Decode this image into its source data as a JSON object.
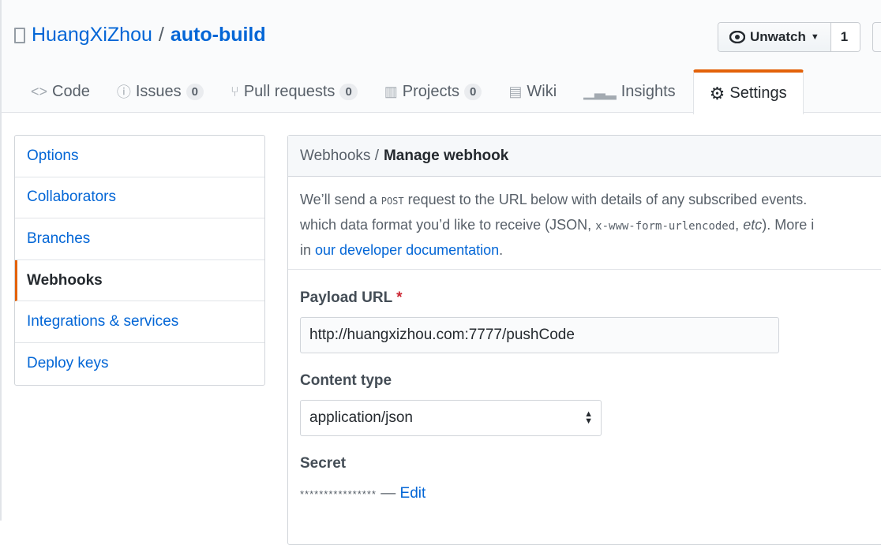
{
  "repo": {
    "owner": "HuangXiZhou",
    "separator": "/",
    "name": "auto-build"
  },
  "watch": {
    "label": "Unwatch",
    "count": "1"
  },
  "tabs": [
    {
      "label": "Code",
      "icon": "code-icon"
    },
    {
      "label": "Issues",
      "count": "0",
      "icon": "issue-icon"
    },
    {
      "label": "Pull requests",
      "count": "0",
      "icon": "pull-request-icon"
    },
    {
      "label": "Projects",
      "count": "0",
      "icon": "project-icon"
    },
    {
      "label": "Wiki",
      "icon": "book-icon"
    },
    {
      "label": "Insights",
      "icon": "graph-icon"
    },
    {
      "label": "Settings",
      "icon": "gear-icon",
      "selected": true
    }
  ],
  "sidebar": {
    "items": [
      {
        "label": "Options"
      },
      {
        "label": "Collaborators"
      },
      {
        "label": "Branches"
      },
      {
        "label": "Webhooks",
        "selected": true
      },
      {
        "label": "Integrations & services"
      },
      {
        "label": "Deploy keys"
      }
    ]
  },
  "main": {
    "breadcrumb": {
      "parent": "Webhooks /",
      "current": "Manage webhook"
    },
    "desc": {
      "l1a": "We’ll send a ",
      "l1code": "POST",
      "l1b": " request to the URL below with details of any subscribed events.",
      "l2a": "which data format you’d like to receive (JSON, ",
      "l2code": "x-www-form-urlencoded",
      "l2b": ", ",
      "l2em": "etc",
      "l2c": "). More i",
      "l3a": "in ",
      "l3link": "our developer documentation",
      "l3b": "."
    },
    "payload_label": "Payload URL",
    "required_mark": "*",
    "payload_value": "http://huangxizhou.com:7777/pushCode",
    "content_type_label": "Content type",
    "content_type_value": "application/json",
    "secret_label": "Secret",
    "secret_mask": "****************",
    "secret_dash": " — ",
    "edit_label": "Edit"
  },
  "colors": {
    "accent": "#e36209",
    "link": "#0366d6"
  }
}
